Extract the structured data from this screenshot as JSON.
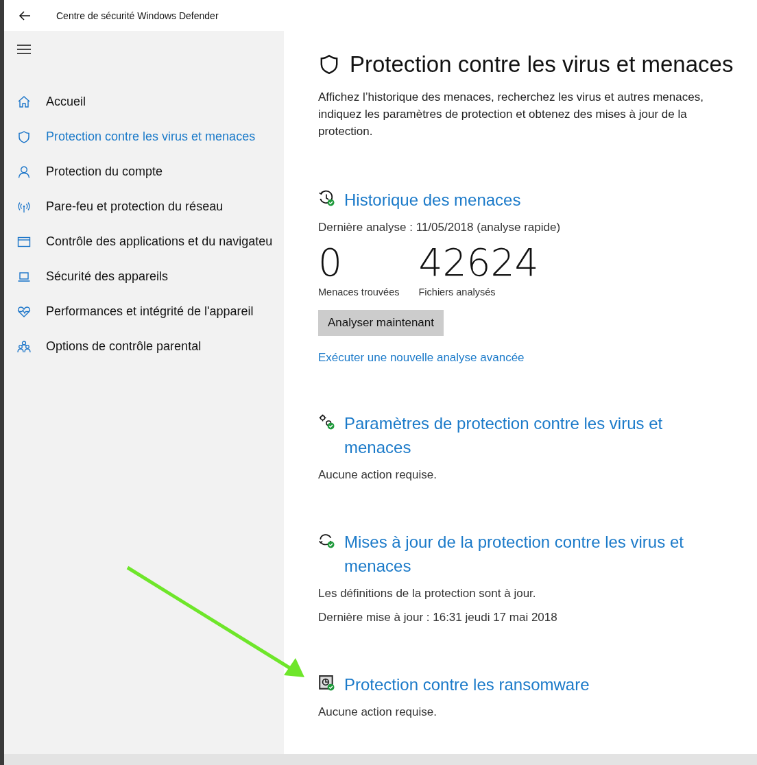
{
  "window": {
    "title": "Centre de sécurité Windows Defender"
  },
  "sidebar": {
    "items": [
      {
        "label": "Accueil",
        "selected": false
      },
      {
        "label": "Protection contre les virus et menaces",
        "selected": true
      },
      {
        "label": "Protection du compte",
        "selected": false
      },
      {
        "label": "Pare-feu et protection du réseau",
        "selected": false
      },
      {
        "label": "Contrôle des applications et du navigateu",
        "selected": false
      },
      {
        "label": "Sécurité des appareils",
        "selected": false
      },
      {
        "label": "Performances et intégrité de l'appareil",
        "selected": false
      },
      {
        "label": "Options de contrôle parental",
        "selected": false
      }
    ]
  },
  "page": {
    "title": "Protection contre les virus et menaces",
    "description": "Affichez l’historique des menaces, recherchez les virus et autres menaces, indiquez les paramètres de protection et obtenez des mises à jour de la protection.",
    "sections": [
      {
        "kind": "history",
        "title": "Historique des menaces",
        "lines": [
          "Dernière analyse : 11/05/2018 (analyse rapide)"
        ],
        "stats": [
          {
            "value": "0",
            "label": "Menaces trouvées"
          },
          {
            "value": "42624",
            "label": "Fichiers analysés"
          }
        ],
        "button": "Analyser maintenant",
        "link": "Exécuter une nouvelle analyse avancée"
      },
      {
        "kind": "settings",
        "title": "Paramètres de protection contre les virus et menaces",
        "lines": [
          "Aucune action requise."
        ]
      },
      {
        "kind": "updates",
        "title": "Mises à jour de la protection contre les virus et menaces",
        "lines": [
          "Les définitions de la protection sont à jour.",
          "Dernière mise à jour : 16:31 jeudi 17 mai 2018"
        ]
      },
      {
        "kind": "ransomware",
        "title": "Protection contre les ransomware",
        "lines": [
          "Aucune action requise."
        ]
      }
    ]
  }
}
